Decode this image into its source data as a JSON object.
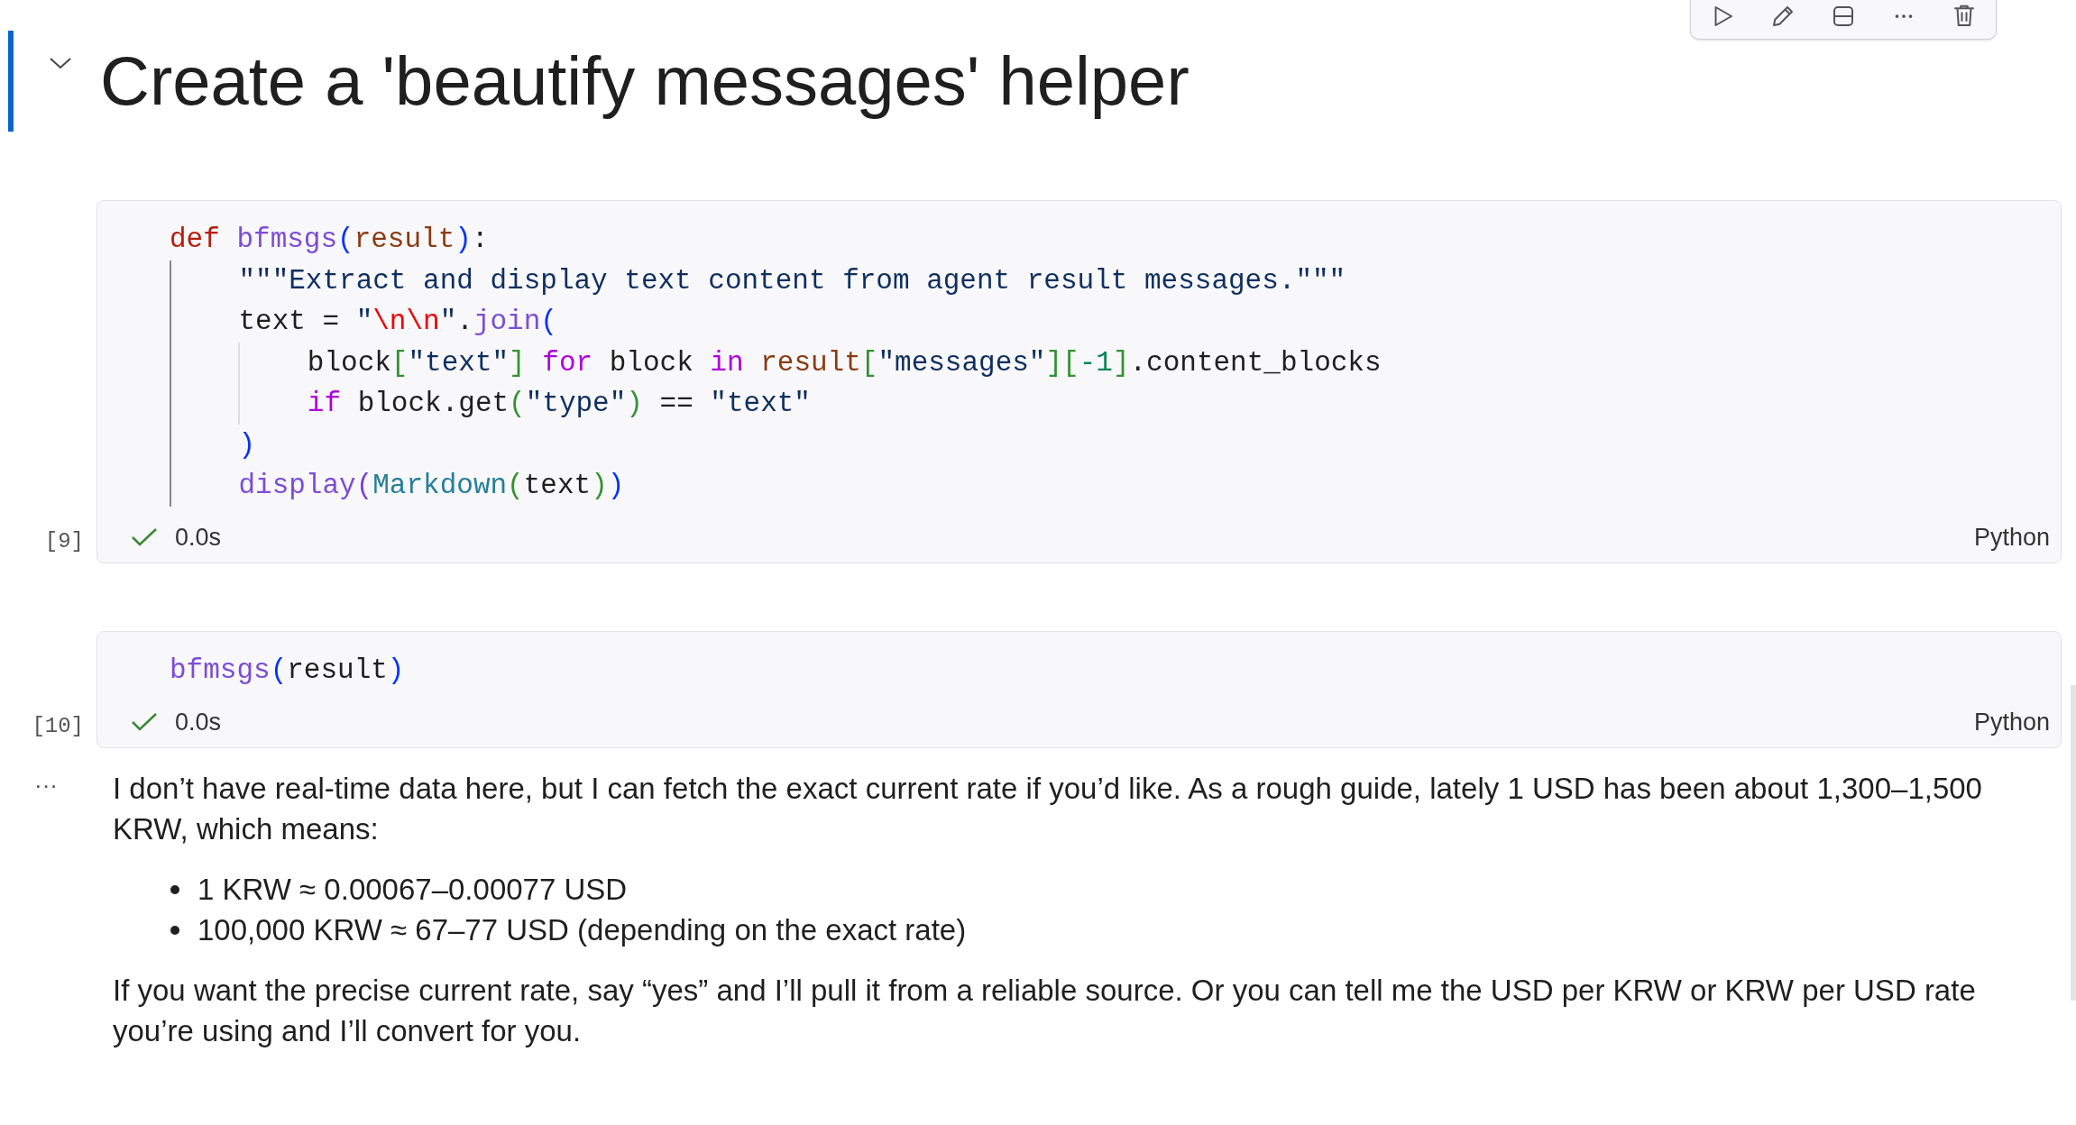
{
  "toolbar": {
    "buttons": [
      {
        "kind": "run"
      },
      {
        "kind": "edit"
      },
      {
        "kind": "split"
      },
      {
        "kind": "more"
      },
      {
        "kind": "delete"
      }
    ]
  },
  "heading": {
    "title": "Create a 'beautify messages' helper",
    "expanded": true,
    "selected": true
  },
  "cells": [
    {
      "execution_count": "[9]",
      "succeeded": true,
      "duration": "0.0s",
      "language": "Python",
      "lines": [
        [
          {
            "text": "def ",
            "kind": "keyword"
          },
          {
            "text": "bfmsgs",
            "kind": "function"
          },
          {
            "text": "(",
            "kind": "bracket1"
          },
          {
            "text": "result",
            "kind": "param"
          },
          {
            "text": ")",
            "kind": "bracket1"
          },
          {
            "text": ":",
            "kind": "plain"
          }
        ],
        [
          {
            "text": "    \"\"\"Extract and display text content from agent result messages.\"\"\"",
            "kind": "docstring"
          }
        ],
        [
          {
            "text": "    text = ",
            "kind": "plain"
          },
          {
            "text": "\"",
            "kind": "string"
          },
          {
            "text": "\\n\\n",
            "kind": "escape"
          },
          {
            "text": "\"",
            "kind": "string"
          },
          {
            "text": ".",
            "kind": "plain"
          },
          {
            "text": "join",
            "kind": "function"
          },
          {
            "text": "(",
            "kind": "bracket1"
          }
        ],
        [
          {
            "text": "        block",
            "kind": "plain"
          },
          {
            "text": "[",
            "kind": "bracket2"
          },
          {
            "text": "\"text\"",
            "kind": "string"
          },
          {
            "text": "]",
            "kind": "bracket2"
          },
          {
            "text": " for",
            "kind": "control"
          },
          {
            "text": " block ",
            "kind": "plain"
          },
          {
            "text": "in",
            "kind": "control"
          },
          {
            "text": " result",
            "kind": "param"
          },
          {
            "text": "[",
            "kind": "bracket2"
          },
          {
            "text": "\"messages\"",
            "kind": "string"
          },
          {
            "text": "][",
            "kind": "bracket2"
          },
          {
            "text": "-1",
            "kind": "number"
          },
          {
            "text": "]",
            "kind": "bracket2"
          },
          {
            "text": ".content_blocks",
            "kind": "plain"
          }
        ],
        [
          {
            "text": "        if",
            "kind": "control"
          },
          {
            "text": " block.get",
            "kind": "plain"
          },
          {
            "text": "(",
            "kind": "bracket2"
          },
          {
            "text": "\"type\"",
            "kind": "string"
          },
          {
            "text": ")",
            "kind": "bracket2"
          },
          {
            "text": " == ",
            "kind": "plain"
          },
          {
            "text": "\"text\"",
            "kind": "string"
          }
        ],
        [
          {
            "text": "    )",
            "kind": "bracket1"
          }
        ],
        [
          {
            "text": "    display",
            "kind": "function"
          },
          {
            "text": "(",
            "kind": "bracket3"
          },
          {
            "text": "Markdown",
            "kind": "class"
          },
          {
            "text": "(",
            "kind": "bracket2"
          },
          {
            "text": "text",
            "kind": "plain"
          },
          {
            "text": ")",
            "kind": "bracket2"
          },
          {
            "text": ")",
            "kind": "bracket1"
          }
        ]
      ]
    },
    {
      "execution_count": "[10]",
      "succeeded": true,
      "duration": "0.0s",
      "language": "Python",
      "lines": [
        [
          {
            "text": "bfmsgs",
            "kind": "function"
          },
          {
            "text": "(",
            "kind": "bracket1"
          },
          {
            "text": "result",
            "kind": "plain"
          },
          {
            "text": ")",
            "kind": "bracket1"
          }
        ]
      ]
    }
  ],
  "output": {
    "menu": "···",
    "blocks": [
      {
        "kind": "paragraph",
        "text": "I don’t have real-time data here, but I can fetch the exact current rate if you’d like. As a rough guide, lately 1 USD has been about 1,300–1,500 KRW, which means:"
      },
      {
        "kind": "list",
        "items": [
          "1 KRW ≈ 0.00067–0.00077 USD",
          "100,000 KRW ≈ 67–77 USD (depending on the exact rate)"
        ]
      },
      {
        "kind": "paragraph",
        "text": "If you want the precise current rate, say “yes” and I’ll pull it from a reliable source. Or you can tell me the USD per KRW or KRW per USD rate you’re using and I’ll convert for you."
      }
    ]
  }
}
